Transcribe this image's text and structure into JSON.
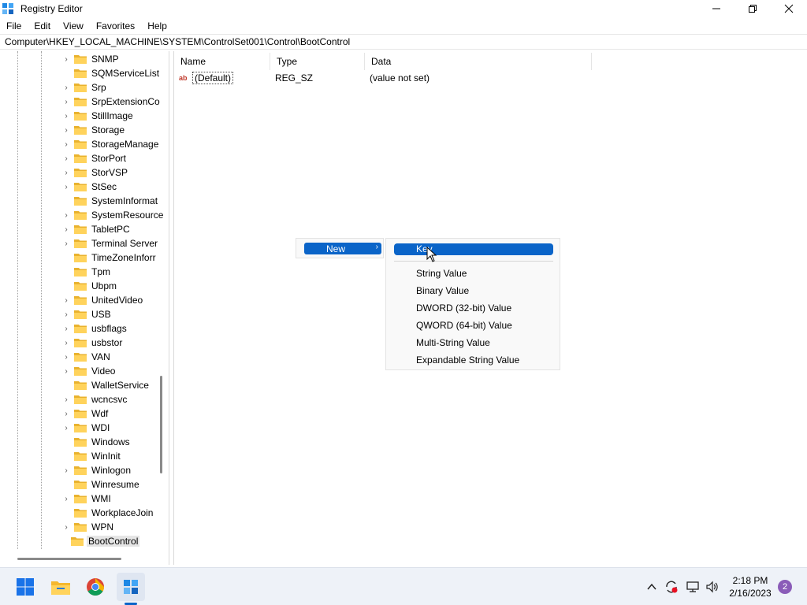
{
  "window": {
    "title": "Registry Editor",
    "icons": {
      "app": "registry-editor-icon",
      "minimize": "minimize-icon",
      "restore": "restore-icon",
      "close": "close-icon"
    }
  },
  "menubar": {
    "items": [
      "File",
      "Edit",
      "View",
      "Favorites",
      "Help"
    ]
  },
  "address": {
    "path": "Computer\\HKEY_LOCAL_MACHINE\\SYSTEM\\ControlSet001\\Control\\BootControl"
  },
  "tree": {
    "items": [
      {
        "label": "SNMP",
        "expandable": true
      },
      {
        "label": "SQMServiceList",
        "expandable": false
      },
      {
        "label": "Srp",
        "expandable": true
      },
      {
        "label": "SrpExtensionCo",
        "expandable": true
      },
      {
        "label": "StillImage",
        "expandable": true
      },
      {
        "label": "Storage",
        "expandable": true
      },
      {
        "label": "StorageManage",
        "expandable": true
      },
      {
        "label": "StorPort",
        "expandable": true
      },
      {
        "label": "StorVSP",
        "expandable": true
      },
      {
        "label": "StSec",
        "expandable": true
      },
      {
        "label": "SystemInformat",
        "expandable": false
      },
      {
        "label": "SystemResource",
        "expandable": true
      },
      {
        "label": "TabletPC",
        "expandable": true
      },
      {
        "label": "Terminal Server",
        "expandable": true
      },
      {
        "label": "TimeZoneInforr",
        "expandable": false
      },
      {
        "label": "Tpm",
        "expandable": false
      },
      {
        "label": "Ubpm",
        "expandable": false
      },
      {
        "label": "UnitedVideo",
        "expandable": true
      },
      {
        "label": "USB",
        "expandable": true
      },
      {
        "label": "usbflags",
        "expandable": true
      },
      {
        "label": "usbstor",
        "expandable": true
      },
      {
        "label": "VAN",
        "expandable": true
      },
      {
        "label": "Video",
        "expandable": true
      },
      {
        "label": "WalletService",
        "expandable": false
      },
      {
        "label": "wcncsvc",
        "expandable": true
      },
      {
        "label": "Wdf",
        "expandable": true
      },
      {
        "label": "WDI",
        "expandable": true
      },
      {
        "label": "Windows",
        "expandable": false
      },
      {
        "label": "WinInit",
        "expandable": false
      },
      {
        "label": "Winlogon",
        "expandable": true
      },
      {
        "label": "Winresume",
        "expandable": false
      },
      {
        "label": "WMI",
        "expandable": true
      },
      {
        "label": "WorkplaceJoin",
        "expandable": false
      },
      {
        "label": "WPN",
        "expandable": true
      },
      {
        "label": "BootControl",
        "expandable": false,
        "selected": true
      }
    ]
  },
  "values_pane": {
    "columns": [
      "Name",
      "Type",
      "Data"
    ],
    "rows": [
      {
        "name": "(Default)",
        "type": "REG_SZ",
        "data": "(value not set)"
      }
    ]
  },
  "context_menu": {
    "parent_item": "New",
    "submenu": {
      "highlighted": "Key",
      "items": [
        "String Value",
        "Binary Value",
        "DWORD (32-bit) Value",
        "QWORD (64-bit) Value",
        "Multi-String Value",
        "Expandable String Value"
      ]
    }
  },
  "taskbar": {
    "apps": [
      "windows-start-icon",
      "file-explorer-icon",
      "chrome-icon",
      "registry-editor-icon"
    ],
    "tray": [
      "chevron-up-icon",
      "sync-icon",
      "network-icon",
      "volume-icon"
    ],
    "time": "2:18 PM",
    "date": "2/16/2023",
    "notification_count": "2"
  },
  "colors": {
    "accent": "#0a64c8",
    "folder": "#f5c542",
    "badge": "#8a5cb8"
  }
}
